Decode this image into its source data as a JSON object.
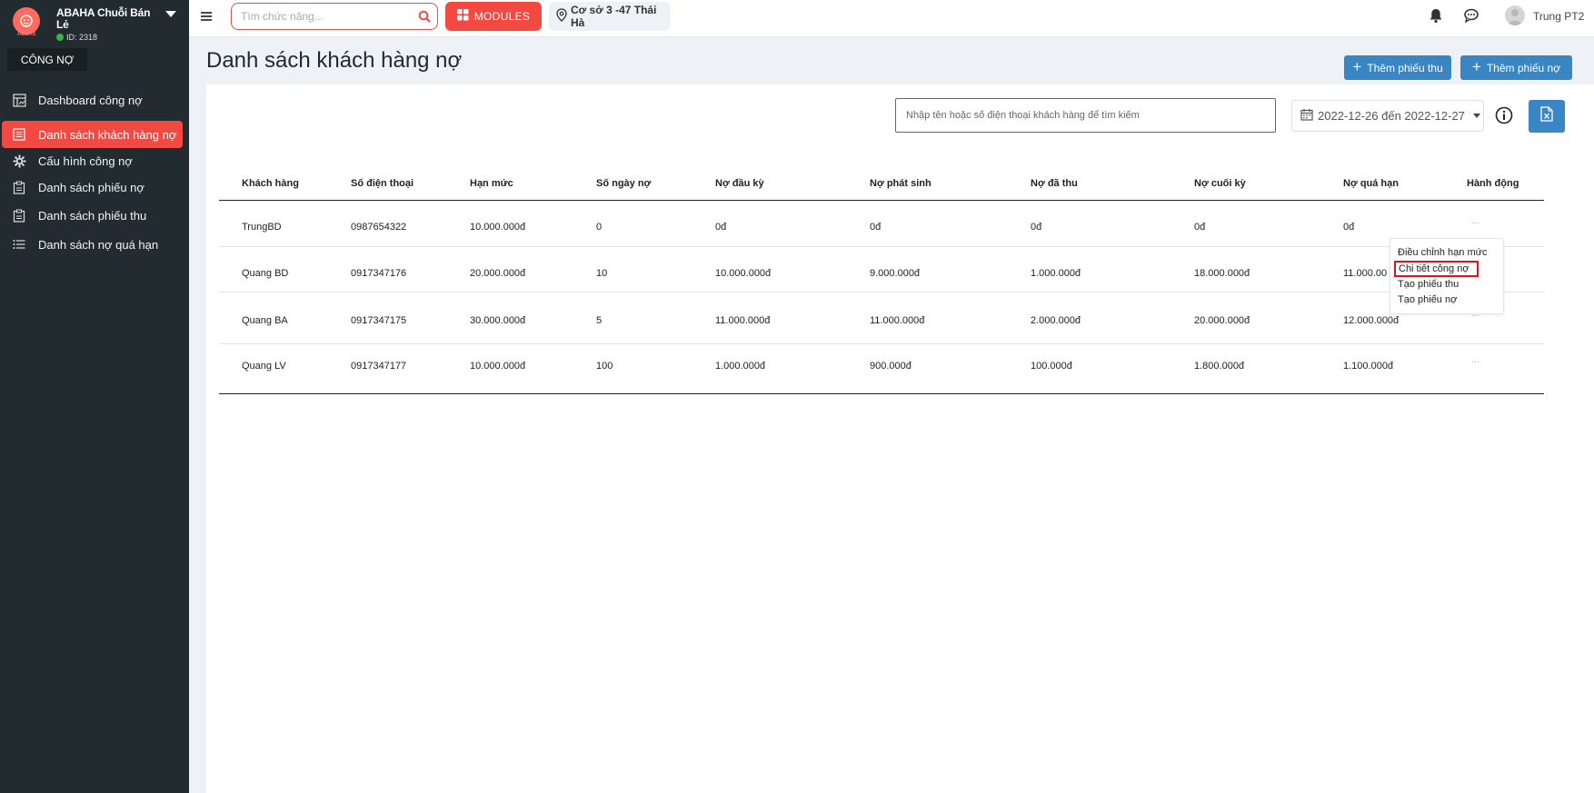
{
  "sidebar": {
    "brand_name": "ABAHA Chuỗi Bán Lẻ",
    "brand_id": "ID: 2318",
    "logo_text": "Abaha",
    "section": "CÔNG NỢ",
    "items": [
      {
        "label": "Dashboard công nợ",
        "icon": "dashboard-icon"
      },
      {
        "label": "Danh sách khách hàng nợ",
        "icon": "list-icon",
        "active": true
      },
      {
        "label": "Cấu hình công nợ",
        "icon": "gear-icon"
      },
      {
        "label": "Danh sách phiếu nợ",
        "icon": "clipboard-icon"
      },
      {
        "label": "Danh sách phiếu thu",
        "icon": "clipboard-icon"
      },
      {
        "label": "Danh sách nợ quá hạn",
        "icon": "bullet-list-icon"
      }
    ]
  },
  "topbar": {
    "search_placeholder": "Tìm chức năng...",
    "modules_label": "MODULES",
    "branch": "Cơ sở 3 -47 Thái Hà",
    "user_name": "Trung PT2"
  },
  "page": {
    "title": "Danh sách khách hàng nợ",
    "btn_add_receipt": "Thêm phiếu thu",
    "btn_add_debt": "Thêm phiếu nợ",
    "customer_search_placeholder": "Nhập tên hoặc số điện thoại khách hàng để tìm kiếm",
    "date_range": "2022-12-26 đến 2022-12-27"
  },
  "table": {
    "headers": [
      "Khách hàng",
      "Số điện thoại",
      "Hạn mức",
      "Số ngày nợ",
      "Nợ đầu kỳ",
      "Nợ phát sinh",
      "Nợ đã thu",
      "Nợ cuối kỳ",
      "Nợ quá hạn",
      "Hành động"
    ],
    "rows": [
      [
        "TrungBD",
        "0987654322",
        "10.000.000đ",
        "0",
        "0đ",
        "0đ",
        "0đ",
        "0đ",
        "0đ"
      ],
      [
        "Quang BD",
        "0917347176",
        "20.000.000đ",
        "10",
        "10.000.000đ",
        "9.000.000đ",
        "1.000.000đ",
        "18.000.000đ",
        "11.000.00"
      ],
      [
        "Quang BA",
        "0917347175",
        "30.000.000đ",
        "5",
        "11.000.000đ",
        "11.000.000đ",
        "2.000.000đ",
        "20.000.000đ",
        "12.000.000đ"
      ],
      [
        "Quang LV",
        "0917347177",
        "10.000.000đ",
        "100",
        "1.000.000đ",
        "900.000đ",
        "100.000đ",
        "1.800.000đ",
        "1.100.000đ"
      ]
    ],
    "action_label": "..."
  },
  "action_menu": {
    "items": [
      "Điều chỉnh hạn mức",
      "Chi tiết công nợ",
      "Tạo phiếu thu",
      "Tạo phiếu nợ"
    ],
    "highlighted_index": 1
  },
  "colors": {
    "sidebar_bg": "#222b2f",
    "accent": "#f24a42",
    "primary_blue": "#3a86c4",
    "highlight_border": "#d9141f"
  }
}
